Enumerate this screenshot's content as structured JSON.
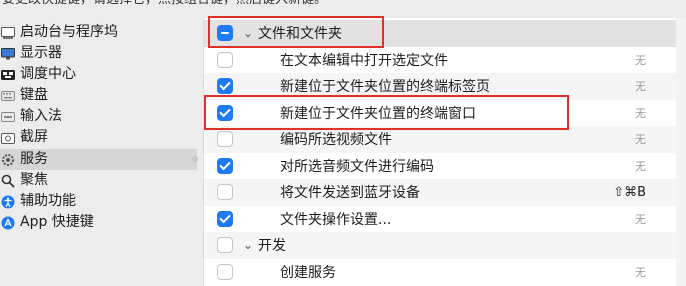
{
  "instruction_text": "要更改快捷键，请选择它，点按组合键，然后键入新键。",
  "sidebar": {
    "items": [
      {
        "label": "启动台与程序坞",
        "icon": "rocket-icon"
      },
      {
        "label": "显示器",
        "icon": "display-icon"
      },
      {
        "label": "调度中心",
        "icon": "mission-control-icon"
      },
      {
        "label": "键盘",
        "icon": "keyboard-icon"
      },
      {
        "label": "输入法",
        "icon": "input-method-icon"
      },
      {
        "label": "截屏",
        "icon": "screenshot-icon"
      },
      {
        "label": "服务",
        "icon": "gear-icon"
      },
      {
        "label": "聚焦",
        "icon": "search-icon"
      },
      {
        "label": "辅助功能",
        "icon": "accessibility-icon"
      },
      {
        "label": "App 快捷键",
        "icon": "app-shortcut-icon"
      }
    ],
    "selected_index": 6
  },
  "services": {
    "rows": [
      {
        "type": "group",
        "label": "文件和文件夹",
        "state": "mixed",
        "expanded": true
      },
      {
        "type": "item",
        "label": "在文本编辑中打开选定文件",
        "checked": false,
        "shortcut": "无"
      },
      {
        "type": "item",
        "label": "新建位于文件夹位置的终端标签页",
        "checked": true,
        "shortcut": "无"
      },
      {
        "type": "item",
        "label": "新建位于文件夹位置的终端窗口",
        "checked": true,
        "shortcut": "无"
      },
      {
        "type": "item",
        "label": "编码所选视频文件",
        "checked": false,
        "shortcut": "无"
      },
      {
        "type": "item",
        "label": "对所选音频文件进行编码",
        "checked": true,
        "shortcut": "无"
      },
      {
        "type": "item",
        "label": "将文件发送到蓝牙设备",
        "checked": false,
        "shortcut": "⇧⌘B"
      },
      {
        "type": "item",
        "label": "文件夹操作设置...",
        "checked": true,
        "shortcut": "无"
      },
      {
        "type": "group",
        "label": "开发",
        "state": "unchecked",
        "expanded": true
      },
      {
        "type": "item",
        "label": "创建服务",
        "checked": false,
        "shortcut": "无"
      }
    ]
  },
  "colors": {
    "accent": "#1f7af6",
    "highlight_box": "#e0302c"
  }
}
